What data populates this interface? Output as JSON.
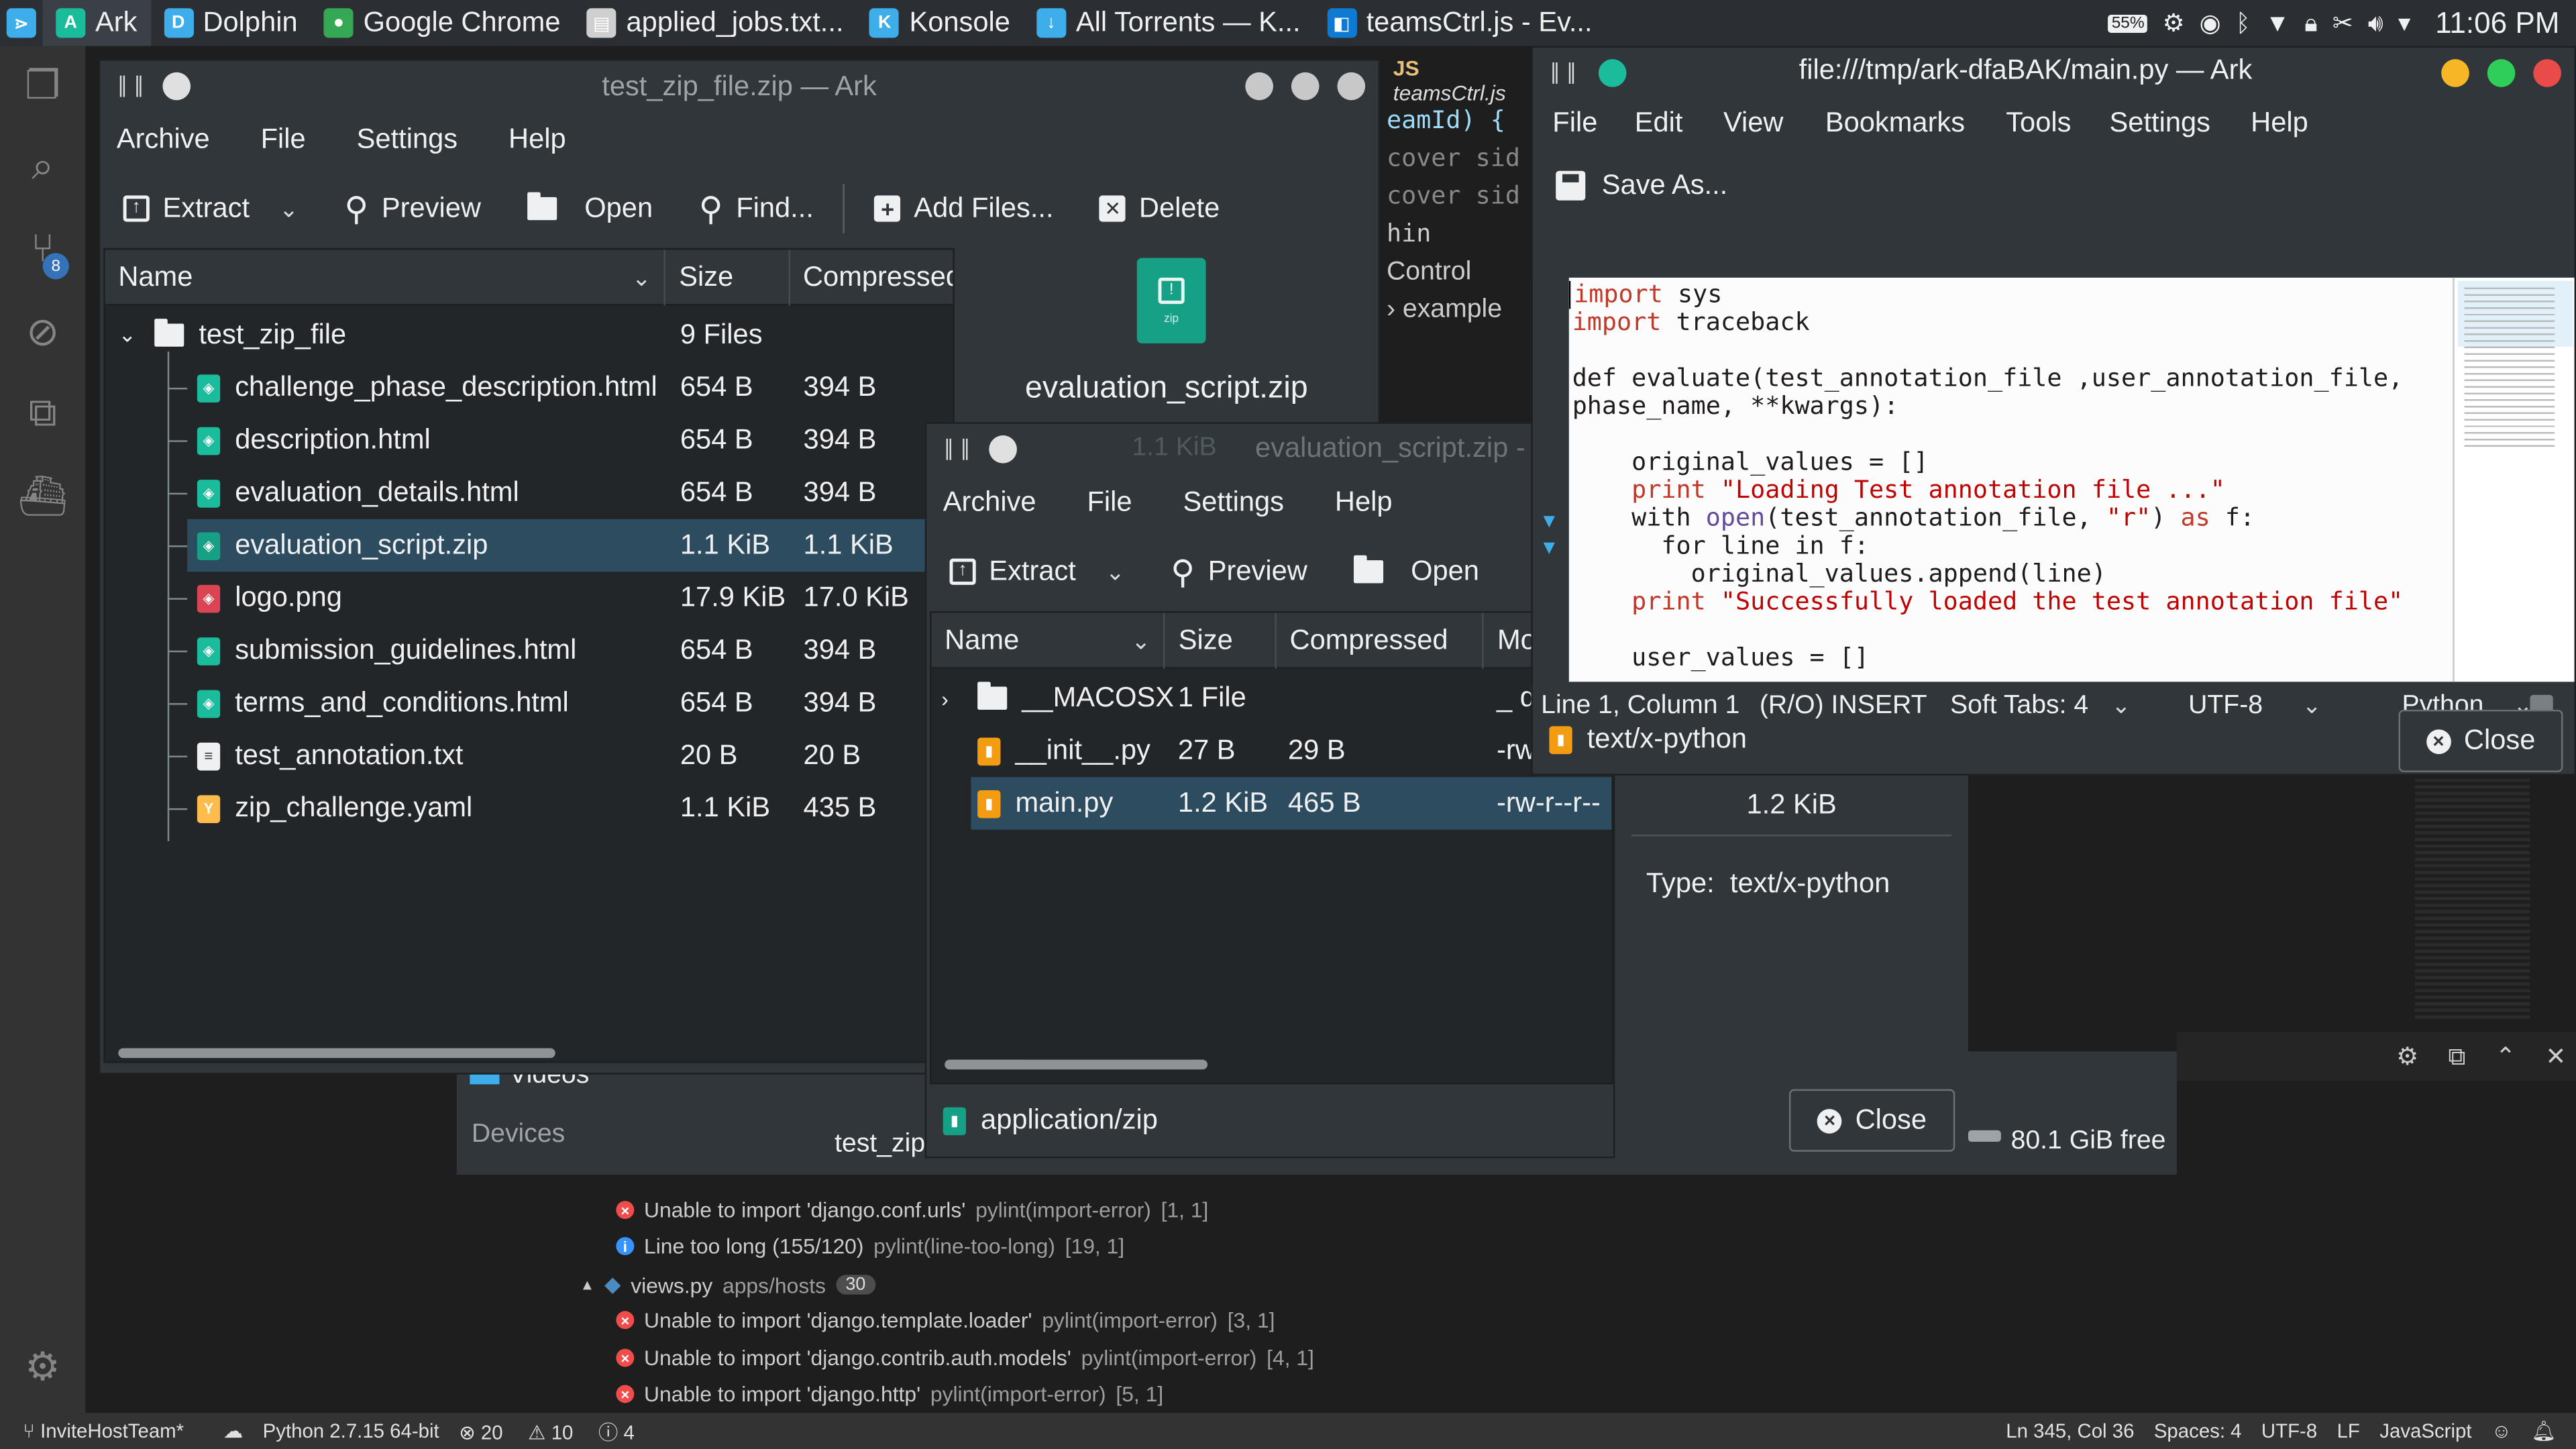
{
  "taskbar": {
    "items": [
      {
        "label": "Ark",
        "color": "#1abc9c"
      },
      {
        "label": "Dolphin",
        "color": "#3daee9"
      },
      {
        "label": "Google Chrome",
        "color": "#34a853"
      },
      {
        "label": "applied_jobs.txt...",
        "color": "#cfcfcf"
      },
      {
        "label": "Konsole",
        "color": "#3daee9"
      },
      {
        "label": "All Torrents — K...",
        "color": "#3daee9"
      },
      {
        "label": "teamsCtrl.js - Ev...",
        "color": "#0e7ad1"
      }
    ],
    "battery": "55%",
    "clock": "11:06 PM"
  },
  "vscode": {
    "editor_lines": [
      "eamId) {",
      "",
      "cover sid",
      "",
      "hin",
      "",
      "Control",
      "",
      "example"
    ],
    "editor_tab": "teamsCtrl.js",
    "source_control_badge": "8",
    "problems": [
      {
        "type": "error",
        "message": "Unable to import 'django.conf.urls'",
        "source": "pylint(import-error)",
        "pos": "[1, 1]"
      },
      {
        "type": "info",
        "message": "Line too long (155/120)",
        "source": "pylint(line-too-long)",
        "pos": "[19, 1]"
      },
      {
        "type": "file",
        "message": "views.py",
        "source": "apps/hosts",
        "pos": "30"
      },
      {
        "type": "error",
        "message": "Unable to import 'django.template.loader'",
        "source": "pylint(import-error)",
        "pos": "[3, 1]"
      },
      {
        "type": "error",
        "message": "Unable to import 'django.contrib.auth.models'",
        "source": "pylint(import-error)",
        "pos": "[4, 1]"
      },
      {
        "type": "error",
        "message": "Unable to import 'django.http'",
        "source": "pylint(import-error)",
        "pos": "[5, 1]"
      }
    ],
    "status": {
      "branch": "InviteHostTeam*",
      "python": "Python 2.7.15 64-bit",
      "errors": "20",
      "warnings": "10",
      "infos": "4",
      "position": "Ln 345, Col 36",
      "spaces": "Spaces: 4",
      "encoding": "UTF-8",
      "eol": "LF",
      "language": "JavaScript"
    }
  },
  "dolphin": {
    "places_item": "Videos",
    "devices_label": "Devices",
    "status_file": "test_zip",
    "free_space": "80.1 GiB free"
  },
  "ark1": {
    "title": "test_zip_file.zip — Ark",
    "menu": [
      "Archive",
      "File",
      "Settings",
      "Help"
    ],
    "toolbar": {
      "extract": "Extract",
      "preview": "Preview",
      "open": "Open",
      "find": "Find...",
      "add_files": "Add Files...",
      "delete": "Delete"
    },
    "columns": {
      "name": "Name",
      "size": "Size",
      "compressed": "Compressed"
    },
    "root": {
      "name": "test_zip_file",
      "size": "9 Files"
    },
    "files": [
      {
        "name": "challenge_phase_description.html",
        "size": "654 B",
        "compressed": "394 B",
        "kind": "html"
      },
      {
        "name": "description.html",
        "size": "654 B",
        "compressed": "394 B",
        "kind": "html"
      },
      {
        "name": "evaluation_details.html",
        "size": "654 B",
        "compressed": "394 B",
        "kind": "html"
      },
      {
        "name": "evaluation_script.zip",
        "size": "1.1 KiB",
        "compressed": "1.1 KiB",
        "kind": "zip"
      },
      {
        "name": "logo.png",
        "size": "17.9 KiB",
        "compressed": "17.0 KiB",
        "kind": "png"
      },
      {
        "name": "submission_guidelines.html",
        "size": "654 B",
        "compressed": "394 B",
        "kind": "html"
      },
      {
        "name": "terms_and_conditions.html",
        "size": "654 B",
        "compressed": "394 B",
        "kind": "html"
      },
      {
        "name": "test_annotation.txt",
        "size": "20 B",
        "compressed": "20 B",
        "kind": "txt"
      },
      {
        "name": "zip_challenge.yaml",
        "size": "1.1 KiB",
        "compressed": "435 B",
        "kind": "yaml"
      }
    ],
    "preview_name": "evaluation_script.zip",
    "preview_icon_label": "zip"
  },
  "ark2": {
    "title": "evaluation_script.zip",
    "bg_size": "1.1 KiB",
    "menu": [
      "Archive",
      "File",
      "Settings",
      "Help"
    ],
    "toolbar": {
      "extract": "Extract",
      "preview": "Preview",
      "open": "Open"
    },
    "columns": {
      "name": "Name",
      "size": "Size",
      "compressed": "Compressed",
      "mode": "Mo"
    },
    "files": [
      {
        "name": "__MACOSX",
        "size": "1 File",
        "compressed": "",
        "mode": "_ dr",
        "kind": "folder"
      },
      {
        "name": "__init__.py",
        "size": "27 B",
        "compressed": "29 B",
        "mode": "-rw",
        "kind": "py"
      },
      {
        "name": "main.py",
        "size": "1.2 KiB",
        "compressed": "465 B",
        "mode": "-rw-r--r--",
        "kind": "py"
      }
    ],
    "mimetype": "application/zip",
    "close": "Close",
    "details_size": "1.2 KiB",
    "details_type_label": "Type:",
    "details_type_value": "text/x-python"
  },
  "kate": {
    "title": "file:///tmp/ark-dfaBAK/main.py — Ark",
    "menu": [
      "File",
      "Edit",
      "View",
      "Bookmarks",
      "Tools",
      "Settings",
      "Help"
    ],
    "save_as": "Save As...",
    "code": [
      [
        {
          "t": "import",
          "c": "kw"
        },
        {
          "t": " sys",
          "c": ""
        }
      ],
      [
        {
          "t": "import",
          "c": "kw"
        },
        {
          "t": " traceback",
          "c": ""
        }
      ],
      [
        {
          "t": "",
          "c": ""
        }
      ],
      [
        {
          "t": "def evaluate(test_annotation_file ,user_annotation_file,",
          "c": ""
        }
      ],
      [
        {
          "t": "phase_name, **kwargs):",
          "c": ""
        }
      ],
      [
        {
          "t": "",
          "c": ""
        }
      ],
      [
        {
          "t": "    original_values = []",
          "c": ""
        }
      ],
      [
        {
          "t": "    ",
          "c": ""
        },
        {
          "t": "print",
          "c": "kw"
        },
        {
          "t": " ",
          "c": ""
        },
        {
          "t": "\"Loading Test annotation file ...\"",
          "c": "str"
        }
      ],
      [
        {
          "t": "    with ",
          "c": ""
        },
        {
          "t": "open",
          "c": "fn"
        },
        {
          "t": "(test_annotation_file, ",
          "c": ""
        },
        {
          "t": "\"r\"",
          "c": "str"
        },
        {
          "t": ") ",
          "c": ""
        },
        {
          "t": "as",
          "c": "kw"
        },
        {
          "t": " f:",
          "c": ""
        }
      ],
      [
        {
          "t": "      for line in f:",
          "c": ""
        }
      ],
      [
        {
          "t": "        original_values.append(line)",
          "c": ""
        }
      ],
      [
        {
          "t": "    ",
          "c": ""
        },
        {
          "t": "print",
          "c": "kw"
        },
        {
          "t": " ",
          "c": ""
        },
        {
          "t": "\"Successfully loaded the test annotation file\"",
          "c": "str"
        }
      ],
      [
        {
          "t": "",
          "c": ""
        }
      ],
      [
        {
          "t": "    user_values = []",
          "c": ""
        }
      ]
    ],
    "status": {
      "position": "Line 1, Column 1",
      "mode": "(R/O) INSERT",
      "tabs": "Soft Tabs: 4",
      "encoding": "UTF-8",
      "language": "Python"
    },
    "mimetype": "text/x-python",
    "close": "Close"
  },
  "colors": {
    "selection": "#2d4c5f",
    "accent": "#3daee9",
    "window": "#31363b",
    "view": "#232629"
  }
}
